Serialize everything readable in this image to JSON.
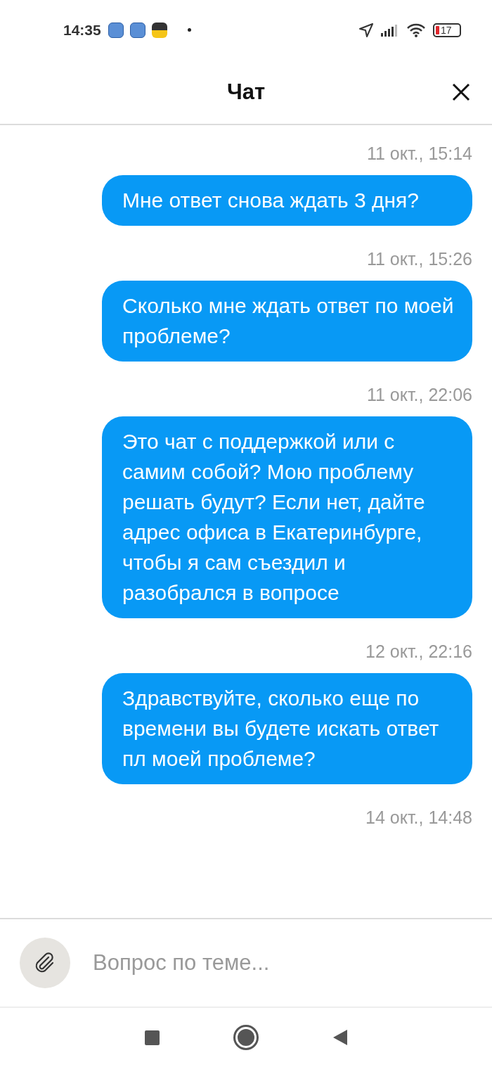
{
  "status_bar": {
    "time": "14:35",
    "battery": "17"
  },
  "header": {
    "title": "Чат"
  },
  "messages": [
    {
      "time": "11 окт., 15:14",
      "text": "Мне ответ снова ждать 3 дня?"
    },
    {
      "time": "11 окт., 15:26",
      "text": "Сколько мне ждать ответ по моей проблеме?"
    },
    {
      "time": "11 окт., 22:06",
      "text": "Это чат с поддержкой или с самим собой? Мою проблему решать будут? Если нет, дайте адрес офиса в Екатеринбурге, чтобы я сам съездил и разобрался в вопросе"
    },
    {
      "time": "12 окт., 22:16",
      "text": "Здравствуйте, сколько еще по времени вы будете искать ответ пл моей проблеме?"
    },
    {
      "time": "14 окт., 14:48"
    }
  ],
  "composer": {
    "placeholder": "Вопрос по теме..."
  }
}
